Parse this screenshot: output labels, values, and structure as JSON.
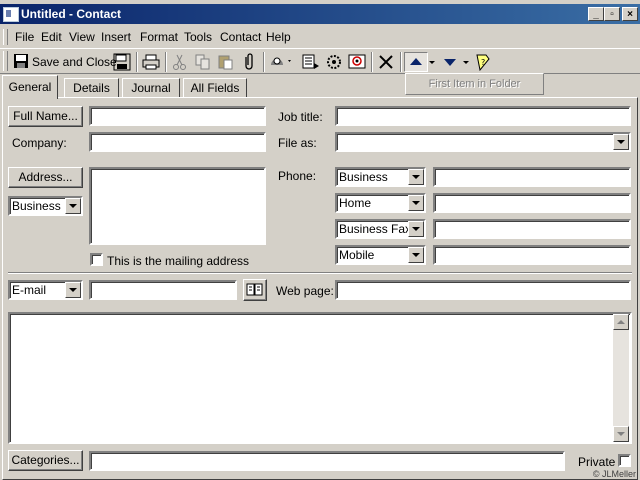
{
  "window": {
    "title": "Untitled - Contact",
    "min_glyph": "_",
    "max_glyph": "▫",
    "close_glyph": "×"
  },
  "menu": [
    {
      "label": "File"
    },
    {
      "label": "Edit"
    },
    {
      "label": "View"
    },
    {
      "label": "Insert"
    },
    {
      "label": "Format"
    },
    {
      "label": "Tools"
    },
    {
      "label": "Contact"
    },
    {
      "label": "Help"
    }
  ],
  "toolbar": {
    "save_close_label": "Save and Close",
    "first_item_label": "First Item in Folder"
  },
  "tabs": [
    {
      "label": "General",
      "active": true
    },
    {
      "label": "Details"
    },
    {
      "label": "Journal"
    },
    {
      "label": "All Fields"
    }
  ],
  "form": {
    "full_name_button": "Full Name...",
    "full_name_value": "",
    "company_label": "Company:",
    "company_value": "",
    "job_title_label": "Job title:",
    "job_title_value": "",
    "file_as_label": "File as:",
    "file_as_value": "",
    "address_button": "Address...",
    "address_type": "Business",
    "address_value": "",
    "mailing_checkbox_label": "This is the mailing address",
    "phone_label": "Phone:",
    "phones": [
      {
        "type": "Business",
        "value": ""
      },
      {
        "type": "Home",
        "value": ""
      },
      {
        "type": "Business Fax",
        "value": ""
      },
      {
        "type": "Mobile",
        "value": ""
      }
    ],
    "email_type": "E-mail",
    "email_value": "",
    "web_page_label": "Web page:",
    "web_page_value": "",
    "notes_value": "",
    "categories_button": "Categories...",
    "categories_value": "",
    "private_label": "Private"
  },
  "footer": {
    "copyright": "© JLMeller"
  }
}
